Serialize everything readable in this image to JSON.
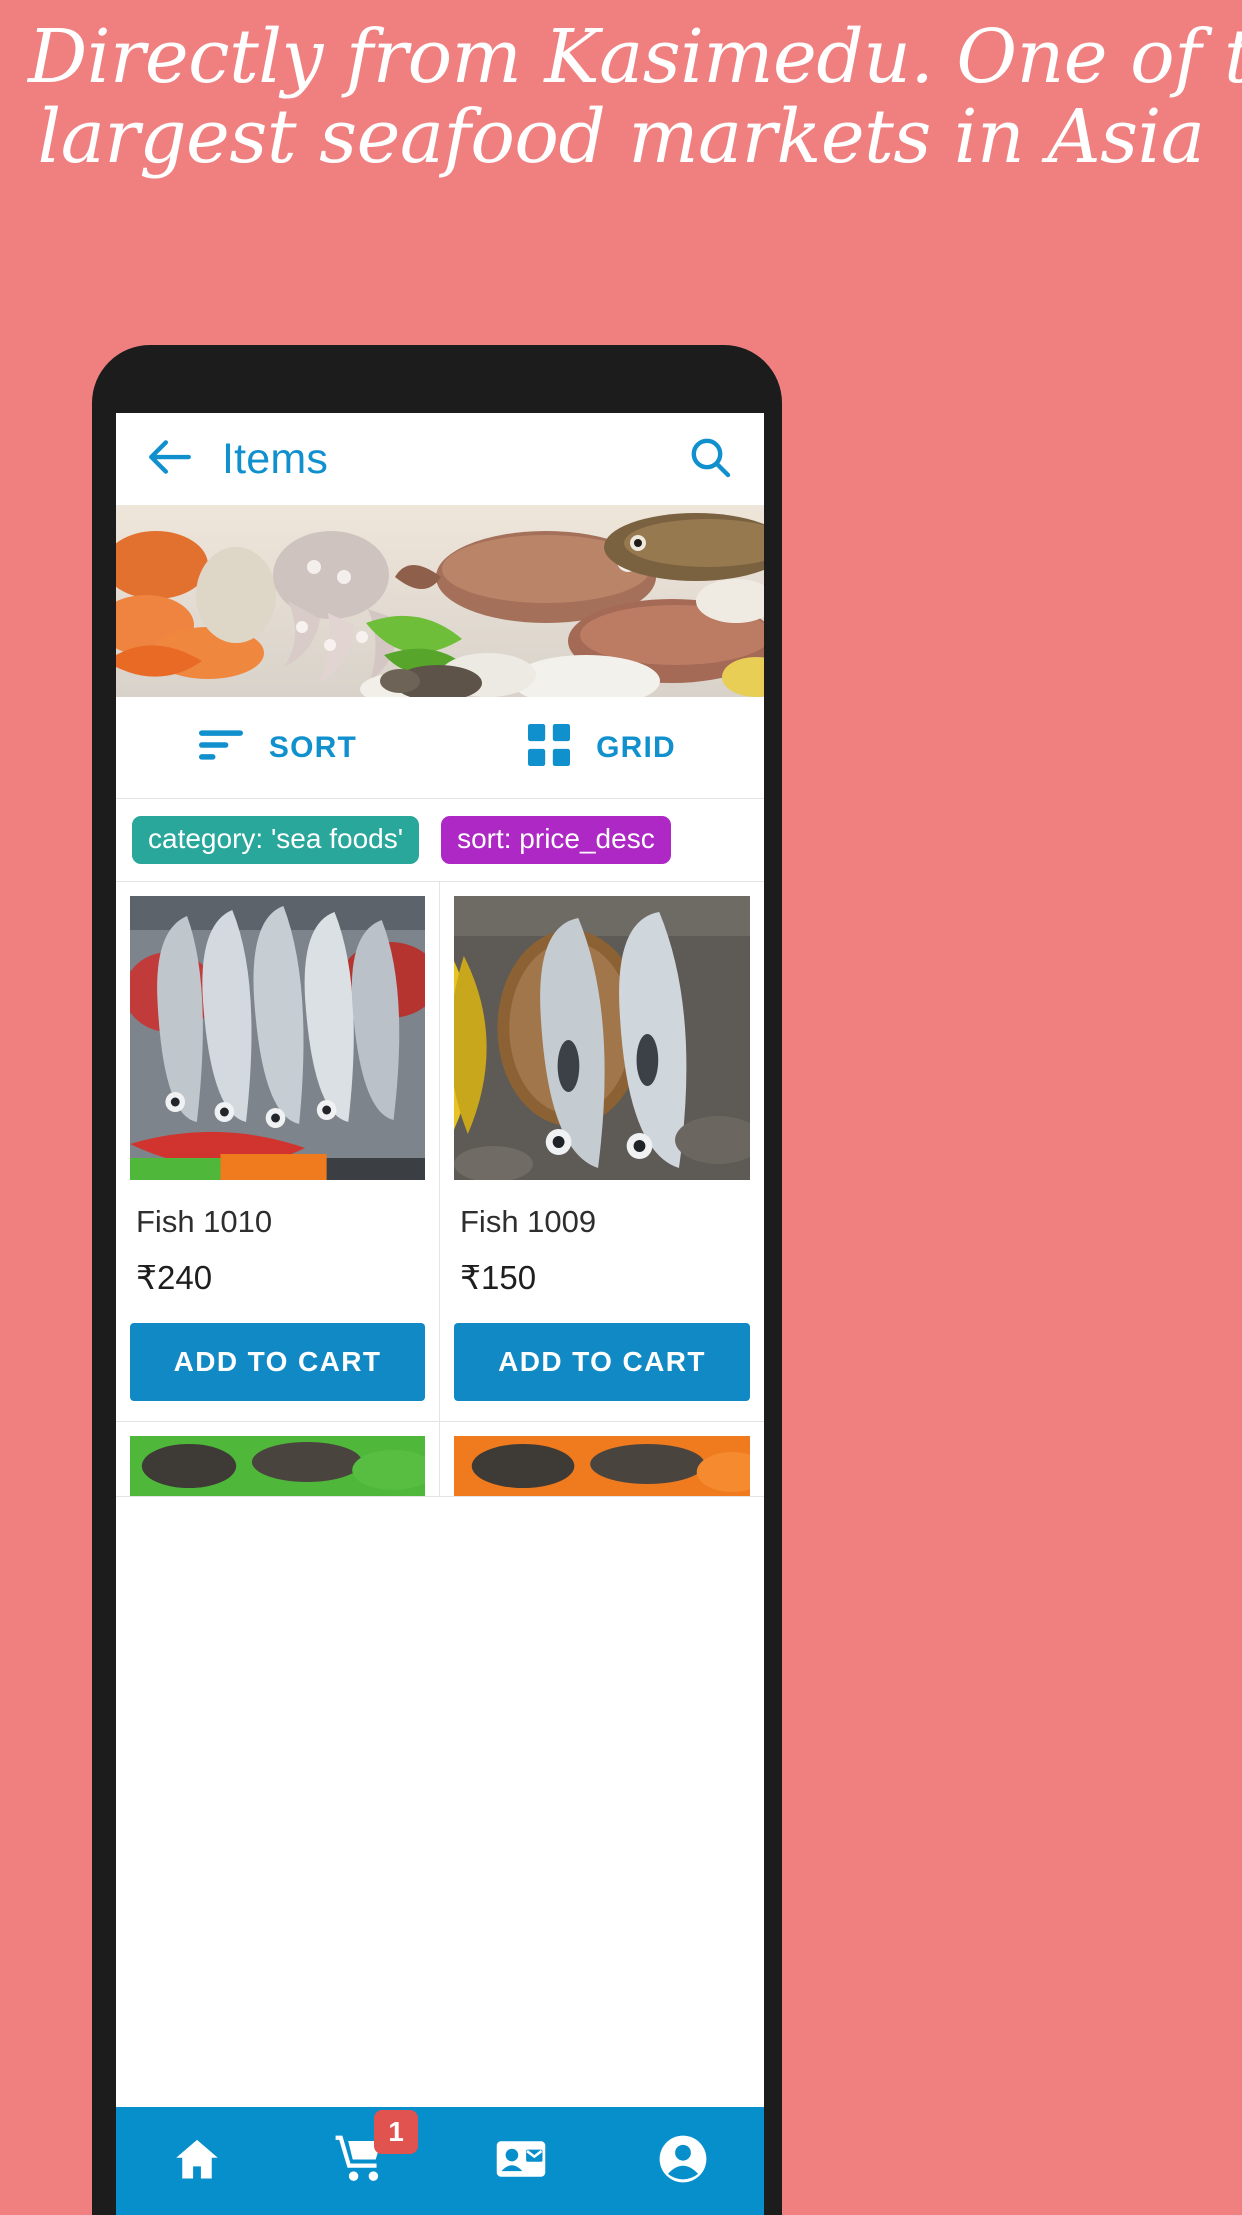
{
  "promo": {
    "line1": "Directly from Kasimedu. One of the",
    "line2": "largest seafood markets in Asia",
    "background_color": "#F08080",
    "text_color": "#FFFFFF"
  },
  "appbar": {
    "back_icon": "back-arrow-icon",
    "title": "Items",
    "search_icon": "search-icon",
    "accent_color": "#1190CE"
  },
  "banner": {
    "alt": "assorted seafood on ice"
  },
  "toolbar": {
    "sort_label": "SORT",
    "sort_icon": "sort-icon",
    "grid_label": "GRID",
    "grid_icon": "grid-icon"
  },
  "chips": [
    {
      "label": "category: 'sea foods'",
      "color": "#2AA79B",
      "name": "chip-category"
    },
    {
      "label": "sort: price_desc",
      "color": "#AD28C4",
      "name": "chip-sort"
    }
  ],
  "products": [
    {
      "title": "Fish 1010",
      "price": "₹240",
      "button": "ADD TO CART"
    },
    {
      "title": "Fish 1009",
      "price": "₹150",
      "button": "ADD TO CART"
    }
  ],
  "bottom_nav": {
    "background_color": "#068FCB",
    "items": [
      {
        "icon": "home-icon",
        "badge": null
      },
      {
        "icon": "shopping-cart-icon",
        "badge": "1"
      },
      {
        "icon": "contact-mail-icon",
        "badge": null
      },
      {
        "icon": "account-circle-icon",
        "badge": null
      }
    ],
    "badge_color": "#E0534F"
  }
}
